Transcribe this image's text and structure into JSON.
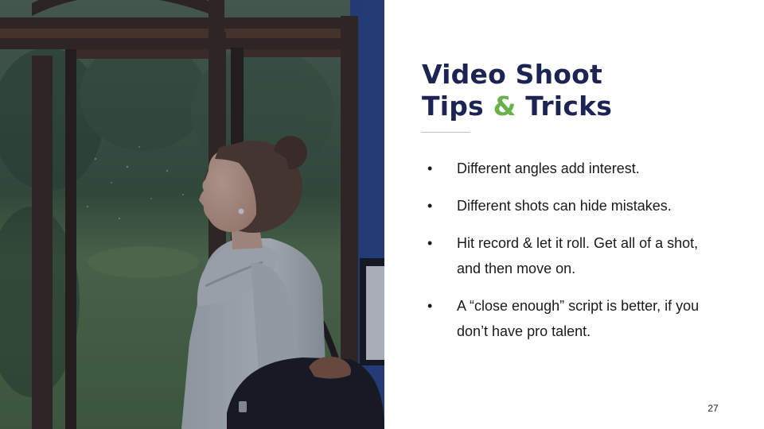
{
  "slide": {
    "title_line1": "Video Shoot",
    "title_line2_a": "Tips ",
    "title_line2_amp": "&",
    "title_line2_b": " Tricks",
    "bullet_symbol": "•",
    "bullets": [
      "Different angles add interest.",
      "Different shots can hide mistakes.",
      "Hit record & let it roll. Get all of a shot, and then move on.",
      "A “close enough” script is better, if you don’t have pro talent."
    ],
    "page_number": "27"
  },
  "colors": {
    "title": "#1b2452",
    "accent_ampersand": "#6ab04c",
    "body_text": "#1a1a1a",
    "wall": "#2b4583",
    "window_frame": "#3f2a1c"
  },
  "photo": {
    "subject": "woman in white sweater with dark shoulder bag standing by a window"
  }
}
